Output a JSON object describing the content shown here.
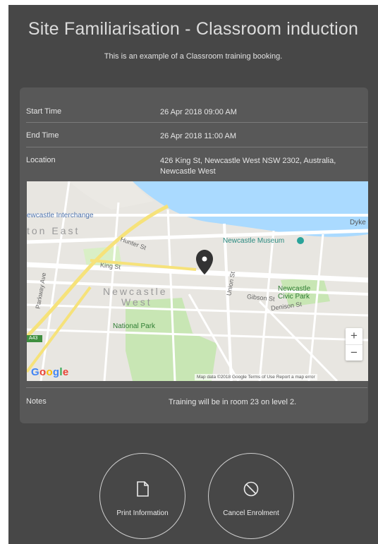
{
  "page": {
    "title": "Site Familiarisation - Classroom induction",
    "subtitle": "This is an example of a Classroom training booking."
  },
  "details": {
    "start_time_label": "Start Time",
    "start_time_value": "26 Apr 2018 09:00 AM",
    "end_time_label": "End Time",
    "end_time_value": "26 Apr 2018 11:00 AM",
    "location_label": "Location",
    "location_value_line1": "426 King St, Newcastle West NSW 2302, Australia,",
    "location_value_line2": "Newcastle West",
    "notes_label": "Notes",
    "notes_value": "Training will be in room 23 on level 2."
  },
  "map": {
    "place_interchange": "ewcastle Interchange",
    "place_east": "ton East",
    "place_museum": "Newcastle Museum",
    "place_dyke": "Dyke",
    "place_newcastle": "Newcastle",
    "place_west": "West",
    "place_civic_park": "Newcastle Civic Park",
    "place_national_park": "National Park",
    "street_hunter": "Hunter St",
    "street_king": "King St",
    "street_union": "Union St",
    "street_parkway": "Parkway Ave",
    "street_gibson": "Gibson St",
    "street_denison": "Denison St",
    "road_shield": "A43",
    "google_logo": "Google",
    "attribution": "Map data ©2018 Google   Terms of Use   Report a map error",
    "zoom_in": "+",
    "zoom_out": "−",
    "colors": {
      "water": "#aadaff",
      "park": "#c8e6b4",
      "road": "#ffffff",
      "major_road": "#f6e27a",
      "pin": "#333333"
    }
  },
  "actions": {
    "print_label": "Print Information",
    "print_icon": "document-icon",
    "cancel_label": "Cancel Enrolment",
    "cancel_icon": "prohibited-icon"
  }
}
